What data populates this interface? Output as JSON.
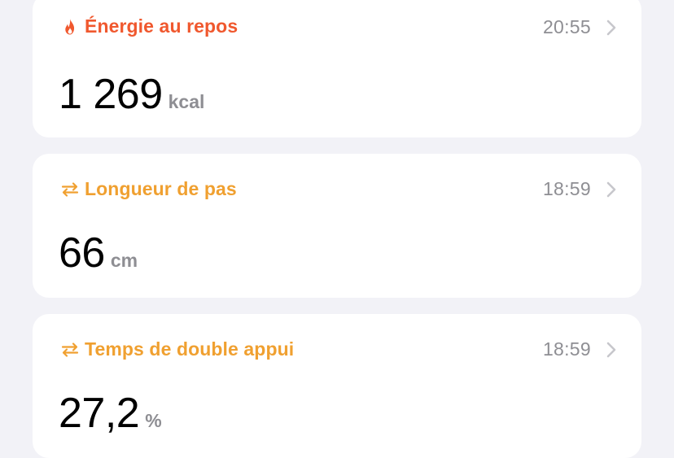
{
  "colors": {
    "energy_accent": "#f0582e",
    "mobility_accent": "#f0a030",
    "secondary_text": "#8e8e93",
    "background": "#f2f2f7"
  },
  "cards": [
    {
      "icon": "flame-icon",
      "title": "Énergie au repos",
      "time": "20:55",
      "value": "1 269",
      "unit": "kcal"
    },
    {
      "icon": "arrows-swap-icon",
      "title": "Longueur de pas",
      "time": "18:59",
      "value": "66",
      "unit": "cm"
    },
    {
      "icon": "arrows-swap-icon",
      "title": "Temps de double appui",
      "time": "18:59",
      "value": "27,2",
      "unit": "%"
    }
  ]
}
